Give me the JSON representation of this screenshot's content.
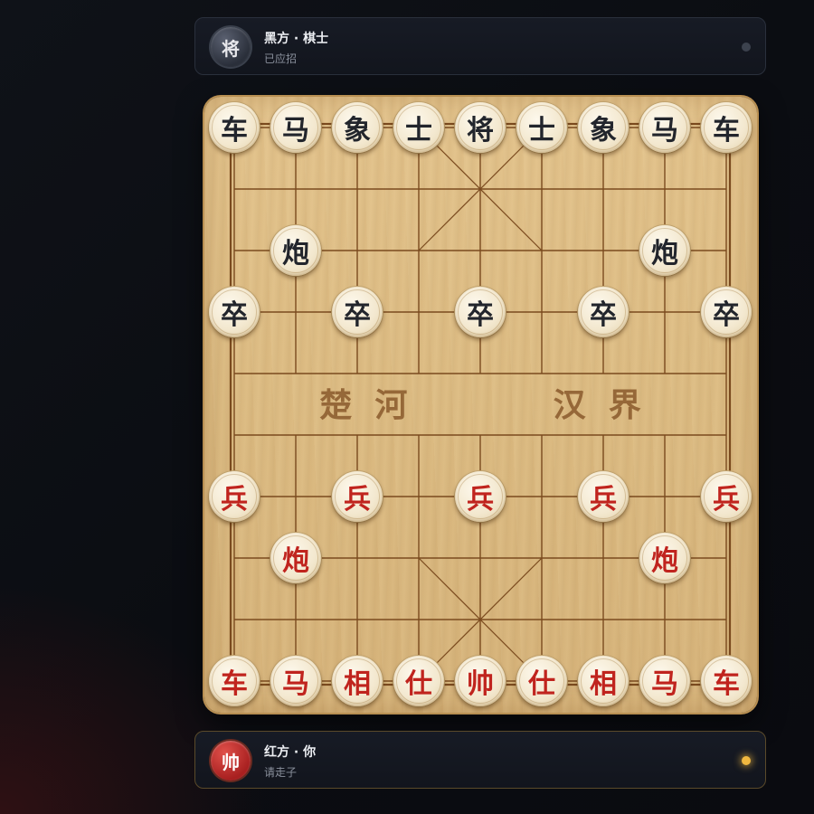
{
  "top_player": {
    "avatar": "将",
    "name": "黑方 · 棋士",
    "status": "已应招",
    "indicator": "idle"
  },
  "bottom_player": {
    "avatar": "帅",
    "name": "红方 · 你",
    "status": "请走子",
    "indicator": "active"
  },
  "board": {
    "river_left": "楚  河",
    "river_right": "汉  界",
    "files": 9,
    "ranks": 10,
    "pieces": [
      {
        "side": "black",
        "char": "车",
        "file": 0,
        "rank": 0
      },
      {
        "side": "black",
        "char": "马",
        "file": 1,
        "rank": 0
      },
      {
        "side": "black",
        "char": "象",
        "file": 2,
        "rank": 0
      },
      {
        "side": "black",
        "char": "士",
        "file": 3,
        "rank": 0
      },
      {
        "side": "black",
        "char": "将",
        "file": 4,
        "rank": 0
      },
      {
        "side": "black",
        "char": "士",
        "file": 5,
        "rank": 0
      },
      {
        "side": "black",
        "char": "象",
        "file": 6,
        "rank": 0
      },
      {
        "side": "black",
        "char": "马",
        "file": 7,
        "rank": 0
      },
      {
        "side": "black",
        "char": "车",
        "file": 8,
        "rank": 0
      },
      {
        "side": "black",
        "char": "炮",
        "file": 1,
        "rank": 2
      },
      {
        "side": "black",
        "char": "炮",
        "file": 7,
        "rank": 2
      },
      {
        "side": "black",
        "char": "卒",
        "file": 0,
        "rank": 3
      },
      {
        "side": "black",
        "char": "卒",
        "file": 2,
        "rank": 3
      },
      {
        "side": "black",
        "char": "卒",
        "file": 4,
        "rank": 3
      },
      {
        "side": "black",
        "char": "卒",
        "file": 6,
        "rank": 3
      },
      {
        "side": "black",
        "char": "卒",
        "file": 8,
        "rank": 3
      },
      {
        "side": "red",
        "char": "兵",
        "file": 0,
        "rank": 6
      },
      {
        "side": "red",
        "char": "兵",
        "file": 2,
        "rank": 6
      },
      {
        "side": "red",
        "char": "兵",
        "file": 4,
        "rank": 6
      },
      {
        "side": "red",
        "char": "兵",
        "file": 6,
        "rank": 6
      },
      {
        "side": "red",
        "char": "兵",
        "file": 8,
        "rank": 6
      },
      {
        "side": "red",
        "char": "炮",
        "file": 1,
        "rank": 7
      },
      {
        "side": "red",
        "char": "炮",
        "file": 7,
        "rank": 7
      },
      {
        "side": "red",
        "char": "车",
        "file": 0,
        "rank": 9
      },
      {
        "side": "red",
        "char": "马",
        "file": 1,
        "rank": 9
      },
      {
        "side": "red",
        "char": "相",
        "file": 2,
        "rank": 9
      },
      {
        "side": "red",
        "char": "仕",
        "file": 3,
        "rank": 9
      },
      {
        "side": "red",
        "char": "帅",
        "file": 4,
        "rank": 9
      },
      {
        "side": "red",
        "char": "仕",
        "file": 5,
        "rank": 9
      },
      {
        "side": "red",
        "char": "相",
        "file": 6,
        "rank": 9
      },
      {
        "side": "red",
        "char": "马",
        "file": 7,
        "rank": 9
      },
      {
        "side": "red",
        "char": "车",
        "file": 8,
        "rank": 9
      }
    ]
  }
}
